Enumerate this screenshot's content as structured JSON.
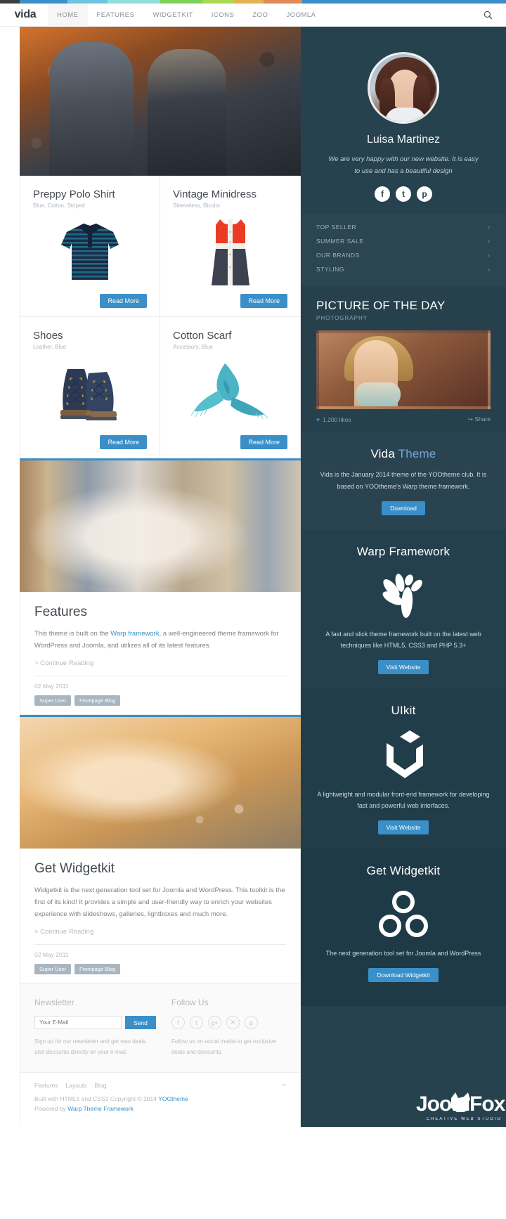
{
  "topbar": {
    "colors": [
      "#3d3d3d",
      "#3a8fc8",
      "#6fc3e0",
      "#8fe0dd",
      "#7fd15a",
      "#a8d94f",
      "#d9d94f",
      "#e8a84f",
      "#e08a5a",
      "#3a8fc8"
    ]
  },
  "header": {
    "logo": "vida",
    "nav": [
      {
        "label": "HOME",
        "active": true
      },
      {
        "label": "FEATURES",
        "active": false
      },
      {
        "label": "WIDGETKIT",
        "active": false
      },
      {
        "label": "ICONS",
        "active": false
      },
      {
        "label": "ZOO",
        "active": false
      },
      {
        "label": "JOOMLA",
        "active": false
      }
    ],
    "search_icon": "search-icon"
  },
  "products": [
    {
      "title": "Preppy Polo Shirt",
      "sub": "Blue, Cotton, Striped",
      "button": "Read More",
      "image": "polo-shirt"
    },
    {
      "title": "Vintage Minidress",
      "sub": "Sleeveless, Bicolor",
      "button": "Read More",
      "image": "minidress"
    },
    {
      "title": "Shoes",
      "sub": "Leather, Blue",
      "button": "Read More",
      "image": "boots"
    },
    {
      "title": "Cotton Scarf",
      "sub": "Accessory, Blue",
      "button": "Read More",
      "image": "scarf"
    }
  ],
  "articles": [
    {
      "title": "Features",
      "body_pre": "This theme is built on the ",
      "body_link": "Warp framework",
      "body_post": ", a well-engineered theme framework for WordPress and Joomla, and utilizes all of its latest features.",
      "continue": "> Continue Reading",
      "date": "02 May 2011",
      "tags": [
        "Super User",
        "Frontpage Blog"
      ]
    },
    {
      "title": "Get Widgetkit",
      "body_pre": "Widgetkit is the next generation tool set for Joomla and WordPress. This toolkit is the first of its kind! It provides a simple and user-friendly way to enrich your websites experience with slideshows, galleries, lightboxes and much more.",
      "body_link": "",
      "body_post": "",
      "continue": "> Continue Reading",
      "date": "02 May 2011",
      "tags": [
        "Super User",
        "Frontpage Blog"
      ]
    }
  ],
  "footer": {
    "newsletter_title": "Newsletter",
    "email_placeholder": "Your E-Mail",
    "send_label": "Send",
    "newsletter_text": "Sign up for our newsletter and get new deals and discounts directly on your e-mail.",
    "follow_title": "Follow Us",
    "follow_text": "Follow us on social media to get exclusive deals and discounts.",
    "socials": [
      "facebook-icon",
      "twitter-icon",
      "google-plus-icon",
      "flickr-icon",
      "pinterest-icon"
    ],
    "links": [
      "Features",
      "Layouts",
      "Blog"
    ],
    "copyright_pre": "Built with HTML5 and CSS3 Copyright © 2014 ",
    "copyright_link": "YOOtheme",
    "powered_pre": "Powered by ",
    "powered_link": "Warp Theme Framework",
    "to_top_icon": "chevron-up-icon"
  },
  "sidebar": {
    "profile": {
      "name": "Luisa Martinez",
      "quote": "We are very happy with our new website. It is easy to use and has a beautiful design",
      "socials": [
        "facebook-icon",
        "twitter-icon",
        "pinterest-icon"
      ]
    },
    "menu": [
      {
        "label": "TOP SELLER",
        "chevron": "‹"
      },
      {
        "label": "SUMMER SALE",
        "chevron": "‹"
      },
      {
        "label": "OUR BRANDS",
        "chevron": "‹"
      },
      {
        "label": "STYLING",
        "chevron": "‹"
      }
    ],
    "picture_of_the_day": {
      "title": "PICTURE OF THE DAY",
      "subtitle": "PHOTOGRAPHY",
      "likes": "1.200 likes",
      "share": "Share"
    },
    "vida": {
      "title_a": "Vida",
      "title_b": "Theme",
      "body": "Vida is the January 2014 theme of the YOOtheme club. It is based on YOOtheme's Warp theme framework.",
      "button": "Download"
    },
    "warp": {
      "title": "Warp Framework",
      "icon": "warp-leaf-icon",
      "body": "A fast and slick theme framework built on the latest web techniques like HTML5, CSS3 and PHP 5.3+",
      "button": "Visit Website"
    },
    "uikit": {
      "title": "UIkit",
      "icon": "uikit-hexagon-icon",
      "body": "A lightweight and modular front-end framework for developing fast and powerful web interfaces.",
      "button": "Visit Website"
    },
    "widgetkit": {
      "title": "Get Widgetkit",
      "icon": "widgetkit-circles-icon",
      "body": "The next generation tool set for Joomla and WordPress",
      "button": "Download Widgetkit"
    },
    "brand": {
      "name": "JoomFox",
      "tagline": "CREATIVE WEB STUDIO"
    }
  },
  "colors": {
    "accent": "#3a8fc8",
    "sidebar_bg": "#27424f",
    "text_dark": "#444a52",
    "text_muted": "#b5bac0"
  }
}
